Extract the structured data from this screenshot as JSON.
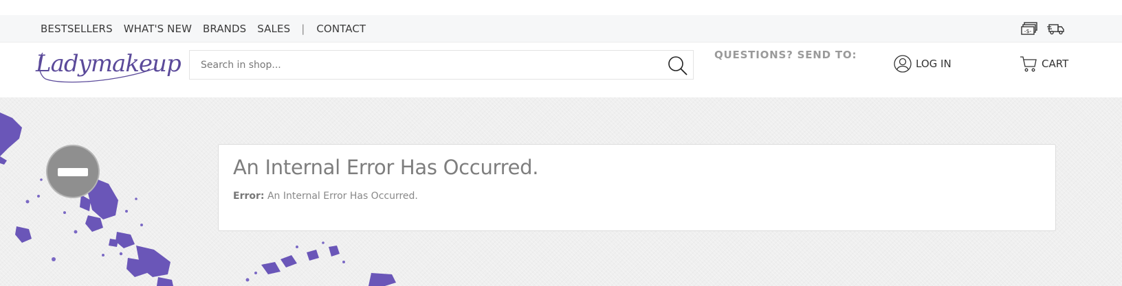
{
  "topnav": {
    "items": [
      {
        "label": "BESTSELLERS"
      },
      {
        "label": "WHAT'S NEW"
      },
      {
        "label": "BRANDS"
      },
      {
        "label": "SALES"
      }
    ],
    "separator": "|",
    "contact": "CONTACT",
    "icons": [
      "cash-icon",
      "delivery-truck-icon"
    ]
  },
  "header": {
    "logo_text": "Ladymakeup",
    "search_placeholder": "Search in shop...",
    "questions_label": "QUESTIONS? SEND TO:",
    "login_label": "LOG IN",
    "cart_label": "CART"
  },
  "error": {
    "title": "An Internal Error Has Occurred.",
    "detail_label": "Error:",
    "detail_text": "An Internal Error Has Occurred."
  },
  "colors": {
    "brand": "#5b4a9a",
    "splatter": "#6a56b8",
    "badge": "#8f8f8f"
  }
}
